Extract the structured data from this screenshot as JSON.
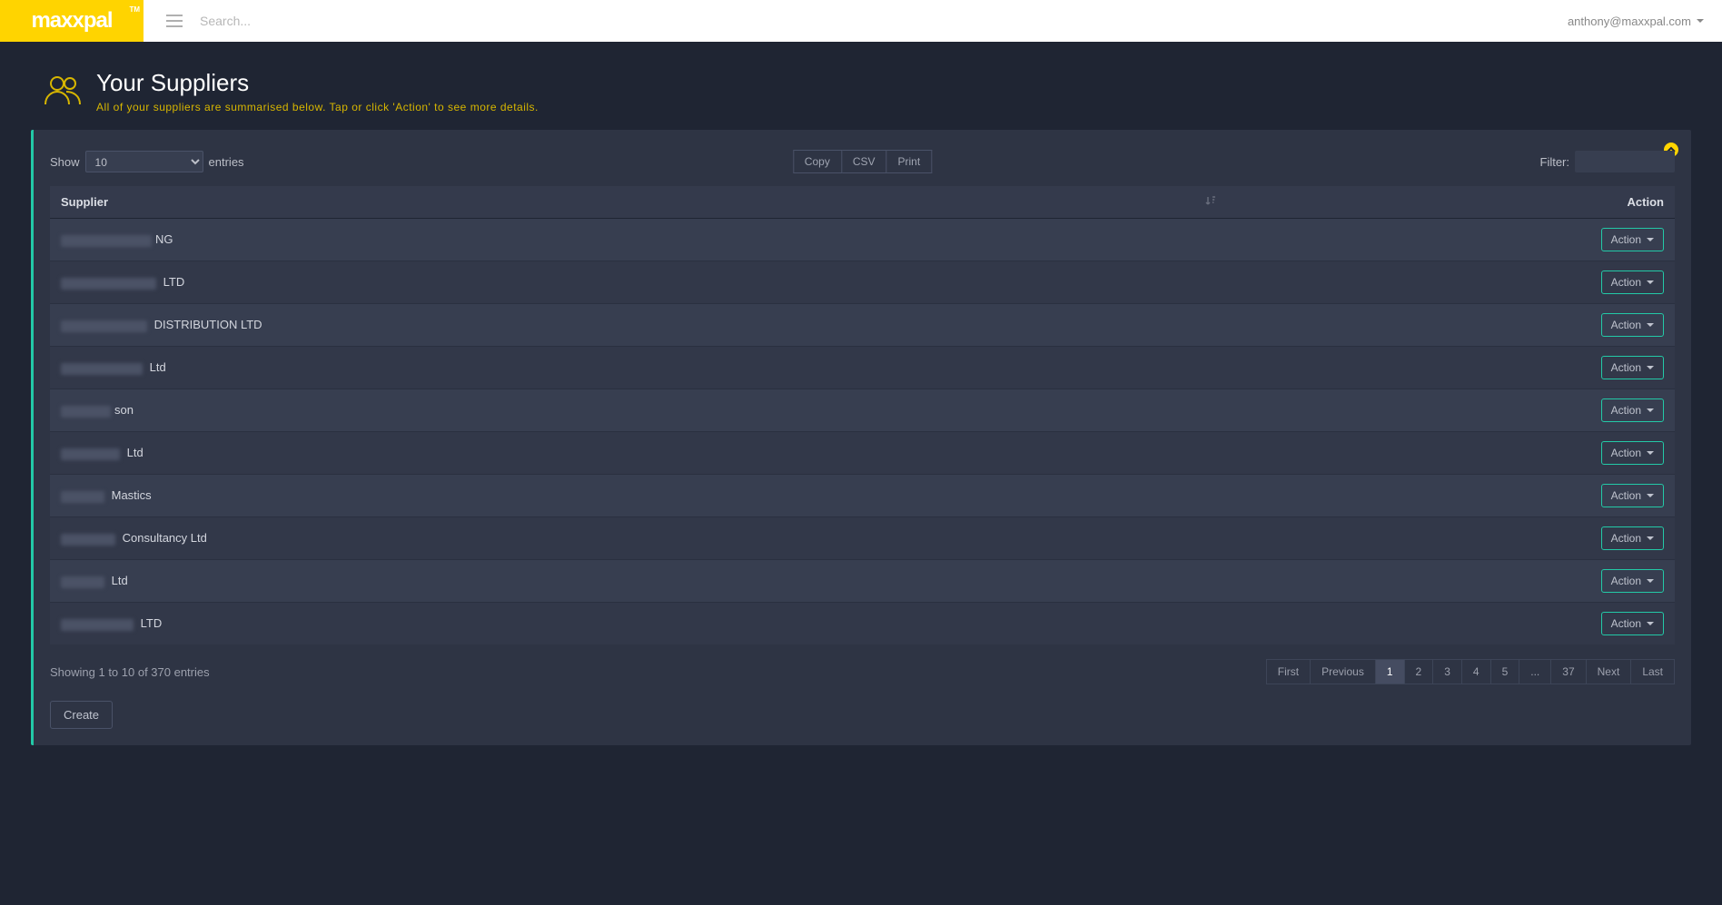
{
  "topbar": {
    "logo_text": "maxxpal",
    "logo_tm": "TM",
    "search_placeholder": "Search...",
    "user_email": "anthony@maxxpal.com"
  },
  "header": {
    "title": "Your Suppliers",
    "subtitle": "All of your suppliers are summarised below. Tap or click 'Action' to see more details."
  },
  "controls": {
    "show_label_before": "Show",
    "show_label_after": "entries",
    "page_size": "10",
    "export": {
      "copy": "Copy",
      "csv": "CSV",
      "print": "Print"
    },
    "filter_label": "Filter:"
  },
  "table": {
    "columns": {
      "supplier": "Supplier",
      "action": "Action"
    },
    "action_label": "Action",
    "rows": [
      {
        "redacted_width": 100,
        "suffix": "NG"
      },
      {
        "redacted_width": 105,
        "suffix": " LTD"
      },
      {
        "redacted_width": 95,
        "suffix": " DISTRIBUTION LTD"
      },
      {
        "redacted_width": 90,
        "suffix": " Ltd"
      },
      {
        "redacted_width": 55,
        "suffix": "son"
      },
      {
        "redacted_width": 65,
        "suffix": " Ltd"
      },
      {
        "redacted_width": 48,
        "suffix": " Mastics"
      },
      {
        "redacted_width": 60,
        "suffix": " Consultancy Ltd"
      },
      {
        "redacted_width": 48,
        "suffix": " Ltd"
      },
      {
        "redacted_width": 80,
        "suffix": " LTD"
      }
    ]
  },
  "footer": {
    "info": "Showing 1 to 10 of 370 entries",
    "pages": [
      "First",
      "Previous",
      "1",
      "2",
      "3",
      "4",
      "5",
      "...",
      "37",
      "Next",
      "Last"
    ],
    "active_page": "1",
    "create": "Create"
  }
}
